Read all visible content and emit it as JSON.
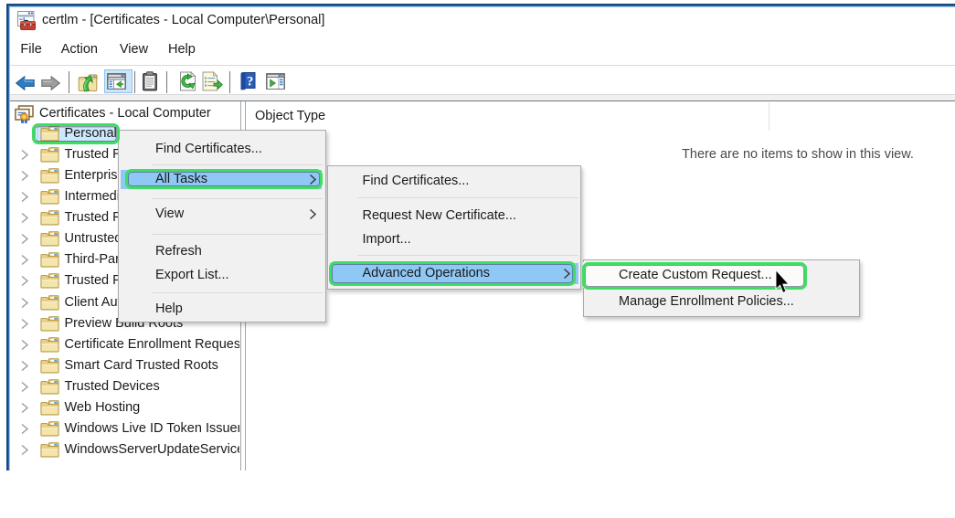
{
  "window": {
    "title": "certlm - [Certificates - Local Computer\\Personal]"
  },
  "menu_bar": {
    "items": [
      "File",
      "Action",
      "View",
      "Help"
    ]
  },
  "toolbar": {
    "buttons": [
      "back",
      "forward",
      "up-one-level",
      "show-console-tree",
      "properties-clipboard",
      "refresh",
      "export-list",
      "help",
      "show-action-pane"
    ],
    "selected_button": "show-console-tree"
  },
  "tree": {
    "root": {
      "label": "Certificates - Local Computer"
    },
    "selected_item": "Personal",
    "items": [
      {
        "label": "Personal",
        "selected": true,
        "expandable": false
      },
      {
        "label": "Trusted Root Certification Authorities",
        "expandable": true
      },
      {
        "label": "Enterprise Trust",
        "expandable": true
      },
      {
        "label": "Intermediate Certification Authorities",
        "expandable": true
      },
      {
        "label": "Trusted Publishers",
        "expandable": true
      },
      {
        "label": "Untrusted Certificates",
        "expandable": true
      },
      {
        "label": "Third-Party Root Certification Authorities",
        "expandable": true
      },
      {
        "label": "Trusted People",
        "expandable": true
      },
      {
        "label": "Client Authentication Issuers",
        "expandable": true
      },
      {
        "label": "Preview Build Roots",
        "expandable": true
      },
      {
        "label": "Certificate Enrollment Requests",
        "expandable": true
      },
      {
        "label": "Smart Card Trusted Roots",
        "expandable": true
      },
      {
        "label": "Trusted Devices",
        "expandable": true
      },
      {
        "label": "Web Hosting",
        "expandable": true
      },
      {
        "label": "Windows Live ID Token Issuer",
        "expandable": true
      },
      {
        "label": "WindowsServerUpdateServices",
        "expandable": true
      }
    ]
  },
  "list_pane": {
    "column_header": "Object Type",
    "empty_message": "There are no items to show in this view."
  },
  "menus": {
    "context": {
      "items": [
        {
          "id": "find-certificates",
          "label": "Find Certificates...",
          "type": "item"
        },
        {
          "type": "separator"
        },
        {
          "id": "all-tasks",
          "label": "All Tasks",
          "type": "submenu",
          "highlighted": true,
          "annotated": true
        },
        {
          "type": "separator"
        },
        {
          "id": "view",
          "label": "View",
          "type": "submenu"
        },
        {
          "type": "separator"
        },
        {
          "id": "refresh",
          "label": "Refresh",
          "type": "item"
        },
        {
          "id": "export-list",
          "label": "Export List...",
          "type": "item"
        },
        {
          "type": "separator"
        },
        {
          "id": "help",
          "label": "Help",
          "type": "item"
        }
      ]
    },
    "all_tasks_submenu": {
      "items": [
        {
          "id": "find-certificates-2",
          "label": "Find Certificates...",
          "type": "item"
        },
        {
          "type": "separator"
        },
        {
          "id": "request-new-certificate",
          "label": "Request New Certificate...",
          "type": "item"
        },
        {
          "id": "import",
          "label": "Import...",
          "type": "item"
        },
        {
          "type": "separator"
        },
        {
          "id": "advanced-operations",
          "label": "Advanced Operations",
          "type": "submenu",
          "highlighted": true,
          "annotated": true
        }
      ]
    },
    "advanced_operations_submenu": {
      "items": [
        {
          "id": "create-custom-request",
          "label": "Create Custom Request...",
          "type": "item",
          "annotated": true
        },
        {
          "id": "manage-enrollment-policies",
          "label": "Manage Enrollment Policies...",
          "type": "item"
        }
      ]
    }
  },
  "annotation": {
    "color": "#3edd63"
  },
  "colors": {
    "window_border": "#3572b4",
    "menu_hover": "#8fc7f5",
    "tree_selection": "#cde9ff",
    "annotation_green": "#3edd63"
  }
}
